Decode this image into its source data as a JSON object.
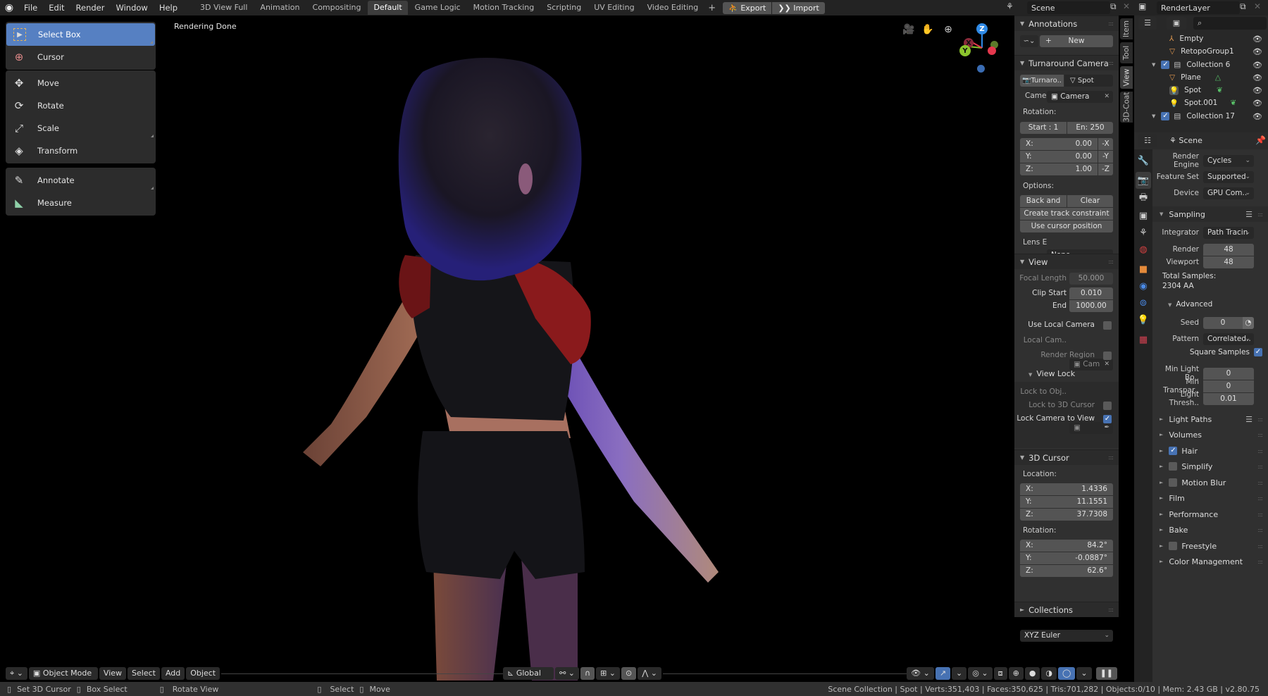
{
  "topbar": {
    "menus": [
      "File",
      "Edit",
      "Render",
      "Window",
      "Help"
    ],
    "workspaces": [
      "3D View Full",
      "Animation",
      "Compositing",
      "Default",
      "Game Logic",
      "Motion Tracking",
      "Scripting",
      "UV Editing",
      "Video Editing"
    ],
    "active_workspace": "Default",
    "add_workspace": "+",
    "export_label": "Export",
    "import_label": "Import",
    "scene": "Scene",
    "view_layer": "RenderLayer"
  },
  "viewport": {
    "status": "Rendering Done",
    "gizmo_axes": {
      "x": "X",
      "y": "Y",
      "z": "Z"
    },
    "colors": {
      "x": "#e5374d",
      "y": "#8bc42d",
      "z": "#2f8ae6",
      "neg_z": "#3a6cb3"
    }
  },
  "toolbar": {
    "items": [
      {
        "label": "Select Box",
        "active": true
      },
      {
        "label": "Cursor"
      },
      {
        "label": "Move"
      },
      {
        "label": "Rotate"
      },
      {
        "label": "Scale"
      },
      {
        "label": "Transform"
      },
      {
        "label": "Annotate"
      },
      {
        "label": "Measure"
      }
    ]
  },
  "header": {
    "mode": "Object Mode",
    "menus": [
      "View",
      "Select",
      "Add",
      "Object"
    ],
    "orientation": "Global"
  },
  "npanel": {
    "tabs": [
      "Item",
      "Tool",
      "View",
      "3D-Coat"
    ],
    "active_tab": "View",
    "annotations": {
      "title": "Annotations",
      "new_label": "New"
    },
    "turnaround": {
      "title": "Turnaround Camera",
      "camera_btn": "Turnaro..",
      "spot_btn": "Spot",
      "camera_label": "Came",
      "camera_value": "Camera",
      "rotation_label": "Rotation:",
      "start": "Start : 1",
      "end": "En:  250",
      "x_label": "X:",
      "x_value": "0.00",
      "x_neg": "-X",
      "y_label": "Y:",
      "y_value": "0.00",
      "y_neg": "-Y",
      "z_label": "Z:",
      "z_value": "1.00",
      "z_neg": "-Z",
      "options_label": "Options:",
      "back_forth": "Back and fo..",
      "clear_camera": "Clear Camera",
      "create_track": "Create track constraint",
      "use_cursor": "Use cursor position",
      "lens_label": "Lens E",
      "lens_value": "None"
    },
    "view": {
      "title": "View",
      "focal_label": "Focal Length",
      "focal_value": "50.000",
      "clip_start_label": "Clip Start",
      "clip_start_value": "0.010",
      "end_label": "End",
      "end_value": "1000.00",
      "use_local_camera": "Use Local Camera",
      "local_cam_label": "Local Cam..",
      "local_cam_value": "Cam",
      "render_region": "Render Region",
      "view_lock_title": "View Lock",
      "lock_obj_label": "Lock to Obj..",
      "lock_3d_cursor": "Lock to 3D Cursor",
      "lock_camera": "Lock Camera to View",
      "lock_camera_checked": true
    },
    "cursor": {
      "title": "3D Cursor",
      "location_label": "Location:",
      "loc": [
        {
          "axis": "X:",
          "value": "1.4336"
        },
        {
          "axis": "Y:",
          "value": "11.1551"
        },
        {
          "axis": "Z:",
          "value": "37.7308"
        }
      ],
      "rotation_label": "Rotation:",
      "rot": [
        {
          "axis": "X:",
          "value": "84.2°"
        },
        {
          "axis": "Y:",
          "value": "-0.0887°"
        },
        {
          "axis": "Z:",
          "value": "62.6°"
        }
      ],
      "mode": "XYZ Euler"
    },
    "collections_title": "Collections"
  },
  "outliner": {
    "items": [
      {
        "label": "Empty",
        "type": "empty"
      },
      {
        "label": "RetopoGroup1",
        "type": "mesh"
      },
      {
        "label": "Collection 6",
        "type": "collection",
        "checked": true
      },
      {
        "label": "Plane",
        "type": "mesh"
      },
      {
        "label": "Spot",
        "type": "light"
      },
      {
        "label": "Spot.001",
        "type": "light"
      },
      {
        "label": "Collection 17",
        "type": "collection",
        "checked": true
      }
    ]
  },
  "properties": {
    "context": "Scene",
    "render_engine_label": "Render Engine",
    "render_engine": "Cycles",
    "feature_set_label": "Feature Set",
    "feature_set": "Supported",
    "device_label": "Device",
    "device": "GPU Com..",
    "sampling_title": "Sampling",
    "integrator_label": "Integrator",
    "integrator": "Path Tracin",
    "render_label": "Render",
    "render_samples": "48",
    "viewport_label": "Viewport",
    "viewport_samples": "48",
    "total_samples_label": "Total Samples:",
    "total_samples": "2304 AA",
    "advanced_title": "Advanced",
    "seed_label": "Seed",
    "seed": "0",
    "pattern_label": "Pattern",
    "pattern": "Correlated..",
    "square_samples": "Square Samples",
    "square_samples_checked": true,
    "min_light_label": "Min Light Bo..",
    "min_light": "0",
    "min_transp_label": "Min Transpar..",
    "min_transp": "0",
    "light_thresh_label": "Light Thresh..",
    "light_thresh": "0.01",
    "sections": [
      {
        "label": "Light Paths"
      },
      {
        "label": "Volumes"
      },
      {
        "label": "Hair",
        "checkbox": true,
        "checked": true
      },
      {
        "label": "Simplify",
        "checkbox": true,
        "checked": false
      },
      {
        "label": "Motion Blur",
        "checkbox": true,
        "checked": false
      },
      {
        "label": "Film"
      },
      {
        "label": "Performance"
      },
      {
        "label": "Bake"
      },
      {
        "label": "Freestyle",
        "checkbox": true,
        "checked": false
      },
      {
        "label": "Color Management"
      }
    ]
  },
  "statusbar": {
    "hints": [
      "Set 3D Cursor",
      "Box Select",
      "Rotate View",
      "Select",
      "Move"
    ],
    "stats": "Scene Collection | Spot | Verts:351,403 | Faces:350,625 | Tris:701,282 | Objects:0/10 | Mem: 2.43 GB | v2.80.75"
  }
}
